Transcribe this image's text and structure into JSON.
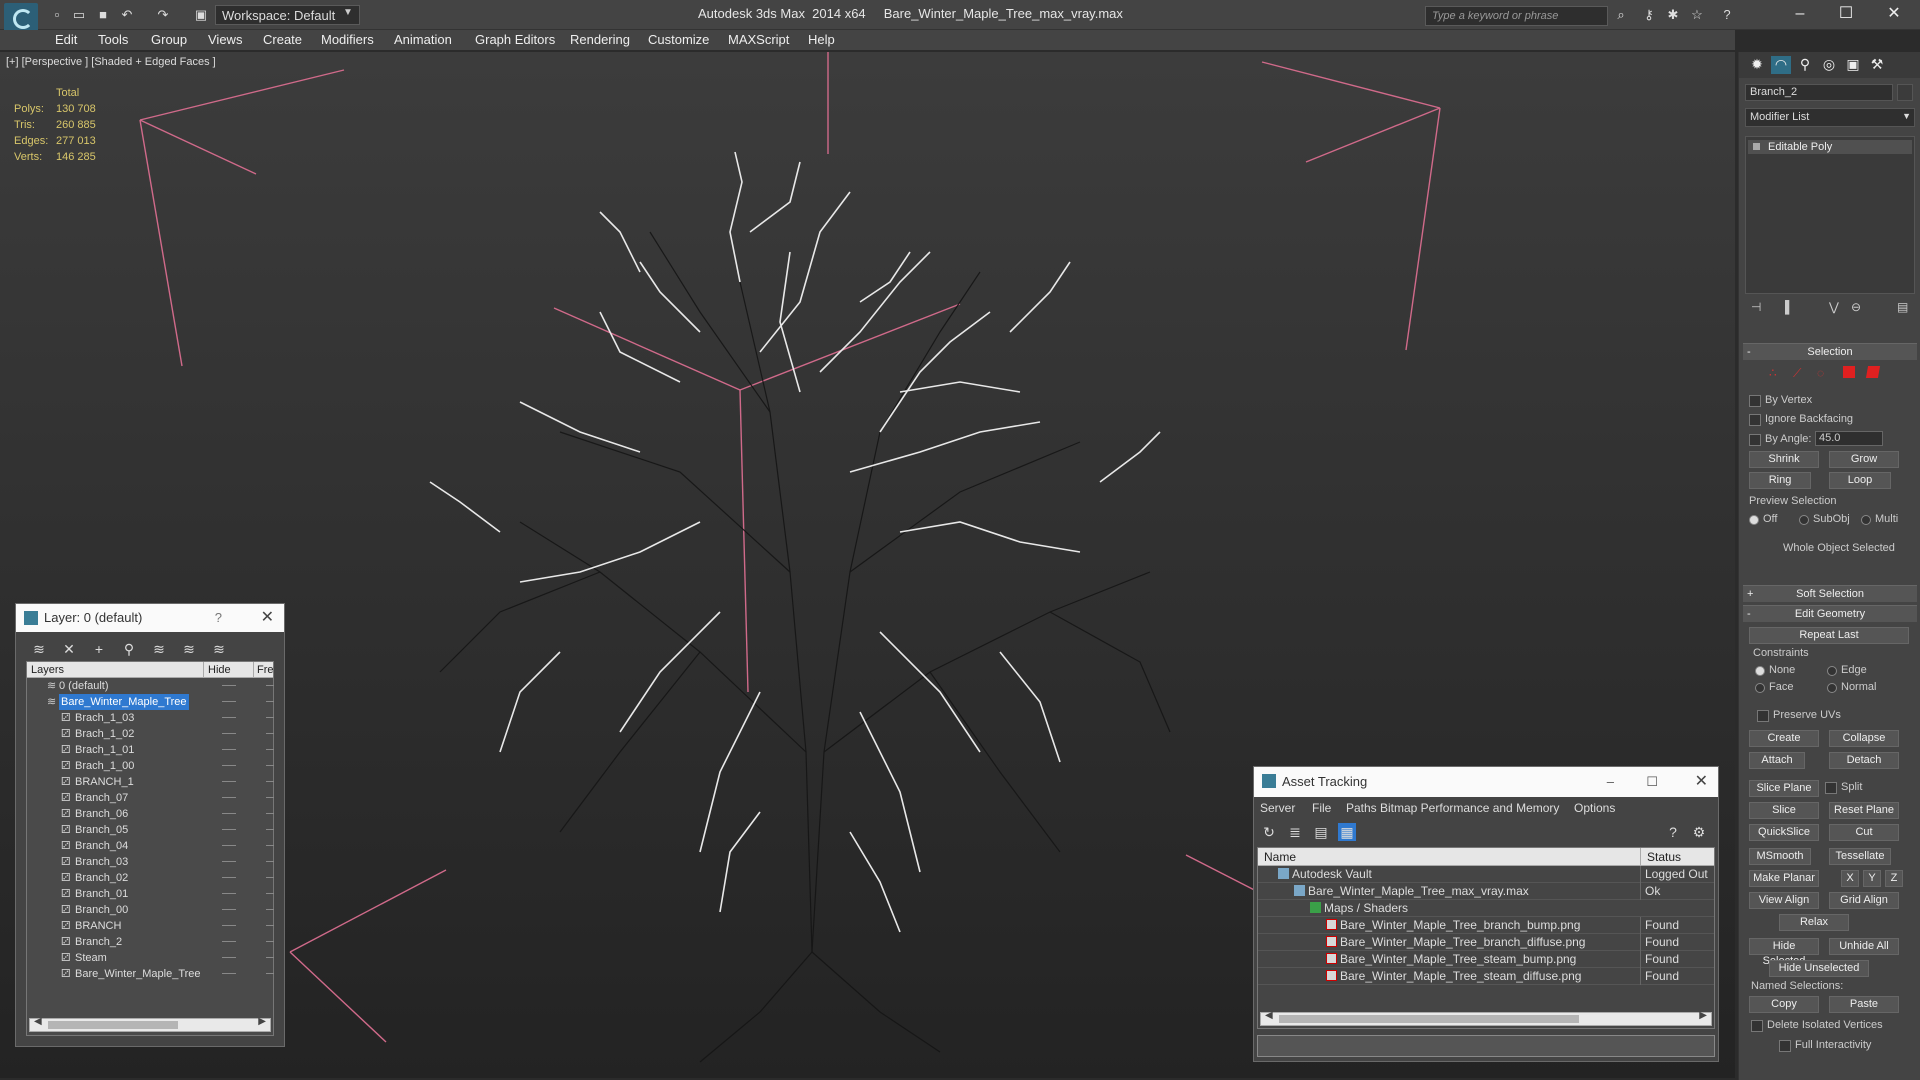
{
  "app": {
    "name": "Autodesk 3ds Max  2014 x64",
    "file": "Bare_Winter_Maple_Tree_max_vray.max",
    "workspace": "Workspace: Default",
    "search_placeholder": "Type a keyword or phrase"
  },
  "menu": [
    "Edit",
    "Tools",
    "Group",
    "Views",
    "Create",
    "Modifiers",
    "Animation",
    "Graph Editors",
    "Rendering",
    "Customize",
    "MAXScript",
    "Help"
  ],
  "viewport": {
    "label": "[+] [Perspective ] [Shaded + Edged Faces ]",
    "stats": {
      "header": "Total",
      "rows": [
        {
          "label": "Polys:",
          "value": "130 708"
        },
        {
          "label": "Tris:",
          "value": "260 885"
        },
        {
          "label": "Edges:",
          "value": "277 013"
        },
        {
          "label": "Verts:",
          "value": "146 285"
        }
      ]
    }
  },
  "command_panel": {
    "object_name": "Branch_2",
    "modifier_list": "Modifier List",
    "stack_item": "Editable Poly",
    "selection": {
      "title": "Selection",
      "by_vertex": "By Vertex",
      "ignore_backfacing": "Ignore Backfacing",
      "by_angle": "By Angle:",
      "angle_value": "45.0",
      "shrink": "Shrink",
      "grow": "Grow",
      "ring": "Ring",
      "loop": "Loop",
      "preview_selection": "Preview Selection",
      "off": "Off",
      "subobj": "SubObj",
      "multi": "Multi",
      "status": "Whole Object Selected"
    },
    "soft_selection": "Soft Selection",
    "edit_geometry": {
      "title": "Edit Geometry",
      "repeat_last": "Repeat Last",
      "constraints": "Constraints",
      "none": "None",
      "edge": "Edge",
      "face": "Face",
      "normal": "Normal",
      "preserve_uvs": "Preserve UVs",
      "create": "Create",
      "collapse": "Collapse",
      "attach": "Attach",
      "detach": "Detach",
      "slice_plane": "Slice Plane",
      "split": "Split",
      "slice": "Slice",
      "reset_plane": "Reset Plane",
      "quickslice": "QuickSlice",
      "cut": "Cut",
      "msmooth": "MSmooth",
      "tessellate": "Tessellate",
      "make_planar": "Make Planar",
      "x": "X",
      "y": "Y",
      "z": "Z",
      "view_align": "View Align",
      "grid_align": "Grid Align",
      "relax": "Relax",
      "hide_selected": "Hide Selected",
      "unhide_all": "Unhide All",
      "hide_unselected": "Hide Unselected",
      "named_selections": "Named Selections:",
      "copy": "Copy",
      "paste": "Paste",
      "delete_isolated": "Delete Isolated Vertices",
      "full_interactivity": "Full Interactivity"
    }
  },
  "layer_panel": {
    "title": "Layer: 0 (default)",
    "help": "?",
    "col_layers": "Layers",
    "col_hide": "Hide",
    "col_freeze": "Fre",
    "rows": [
      {
        "name": "0 (default)",
        "indent": 1,
        "selected": false
      },
      {
        "name": "Bare_Winter_Maple_Tree",
        "indent": 1,
        "selected": true
      },
      {
        "name": "Brach_1_03",
        "indent": 2,
        "selected": false
      },
      {
        "name": "Brach_1_02",
        "indent": 2,
        "selected": false
      },
      {
        "name": "Brach_1_01",
        "indent": 2,
        "selected": false
      },
      {
        "name": "Brach_1_00",
        "indent": 2,
        "selected": false
      },
      {
        "name": "BRANCH_1",
        "indent": 2,
        "selected": false
      },
      {
        "name": "Branch_07",
        "indent": 2,
        "selected": false
      },
      {
        "name": "Branch_06",
        "indent": 2,
        "selected": false
      },
      {
        "name": "Branch_05",
        "indent": 2,
        "selected": false
      },
      {
        "name": "Branch_04",
        "indent": 2,
        "selected": false
      },
      {
        "name": "Branch_03",
        "indent": 2,
        "selected": false
      },
      {
        "name": "Branch_02",
        "indent": 2,
        "selected": false
      },
      {
        "name": "Branch_01",
        "indent": 2,
        "selected": false
      },
      {
        "name": "Branch_00",
        "indent": 2,
        "selected": false
      },
      {
        "name": "BRANCH",
        "indent": 2,
        "selected": false
      },
      {
        "name": "Branch_2",
        "indent": 2,
        "selected": false
      },
      {
        "name": "Steam",
        "indent": 2,
        "selected": false
      },
      {
        "name": "Bare_Winter_Maple_Tree",
        "indent": 2,
        "selected": false
      }
    ]
  },
  "asset_panel": {
    "title": "Asset Tracking",
    "menu": [
      "Server",
      "File",
      "Paths",
      "Bitmap Performance and Memory",
      "Options"
    ],
    "col_name": "Name",
    "col_status": "Status",
    "rows": [
      {
        "name": "Autodesk Vault",
        "status": "Logged Out ."
      },
      {
        "name": "Bare_Winter_Maple_Tree_max_vray.max",
        "status": "Ok"
      },
      {
        "name": "Maps / Shaders",
        "status": ""
      },
      {
        "name": "Bare_Winter_Maple_Tree_branch_bump.png",
        "status": "Found"
      },
      {
        "name": "Bare_Winter_Maple_Tree_branch_diffuse.png",
        "status": "Found"
      },
      {
        "name": "Bare_Winter_Maple_Tree_steam_bump.png",
        "status": "Found"
      },
      {
        "name": "Bare_Winter_Maple_Tree_steam_diffuse.png",
        "status": "Found"
      }
    ]
  }
}
